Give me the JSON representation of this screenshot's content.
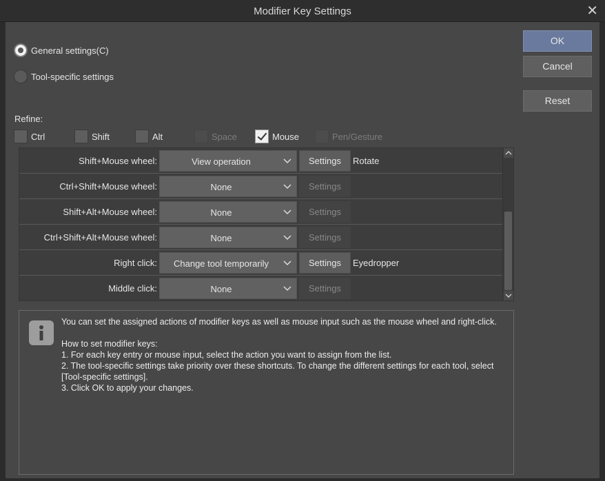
{
  "window": {
    "title": "Modifier Key Settings"
  },
  "buttons": {
    "ok": "OK",
    "cancel": "Cancel",
    "reset": "Reset"
  },
  "scope": {
    "general": "General settings(C)",
    "tool_specific": "Tool-specific settings",
    "selected": "general"
  },
  "refine": {
    "label": "Refine:",
    "options": [
      {
        "label": "Ctrl",
        "checked": false,
        "enabled": true
      },
      {
        "label": "Shift",
        "checked": false,
        "enabled": true
      },
      {
        "label": "Alt",
        "checked": false,
        "enabled": true
      },
      {
        "label": "Space",
        "checked": false,
        "enabled": false
      },
      {
        "label": "Mouse",
        "checked": true,
        "enabled": true
      },
      {
        "label": "Pen/Gesture",
        "checked": false,
        "enabled": false
      }
    ]
  },
  "rows": [
    {
      "input": "Shift+Mouse wheel:",
      "action": "View operation",
      "settings": "Settings",
      "settings_enabled": true,
      "assigned": "Rotate"
    },
    {
      "input": "Ctrl+Shift+Mouse wheel:",
      "action": "None",
      "settings": "Settings",
      "settings_enabled": false,
      "assigned": ""
    },
    {
      "input": "Shift+Alt+Mouse wheel:",
      "action": "None",
      "settings": "Settings",
      "settings_enabled": false,
      "assigned": ""
    },
    {
      "input": "Ctrl+Shift+Alt+Mouse wheel:",
      "action": "None",
      "settings": "Settings",
      "settings_enabled": false,
      "assigned": ""
    },
    {
      "input": "Right click:",
      "action": "Change tool temporarily",
      "settings": "Settings",
      "settings_enabled": true,
      "assigned": "Eyedropper"
    },
    {
      "input": "Middle click:",
      "action": "None",
      "settings": "Settings",
      "settings_enabled": false,
      "assigned": ""
    }
  ],
  "info": {
    "line1": "You can set the assigned actions of modifier keys as well as mouse input such as the mouse wheel and right-click.",
    "heading": "How to set modifier keys:",
    "step1": "1. For each key entry or mouse input, select the action you want to assign from the list.",
    "step2": "2. The tool-specific settings take priority over these shortcuts. To change the different settings for each tool, select [Tool-specific settings].",
    "step3": "3. Click OK to apply your changes."
  },
  "icons": {
    "close": "close-icon",
    "info": "info-icon",
    "dropdown": "chevron-down-icon",
    "scroll_up": "chevron-up-icon",
    "scroll_down": "chevron-down-icon"
  }
}
